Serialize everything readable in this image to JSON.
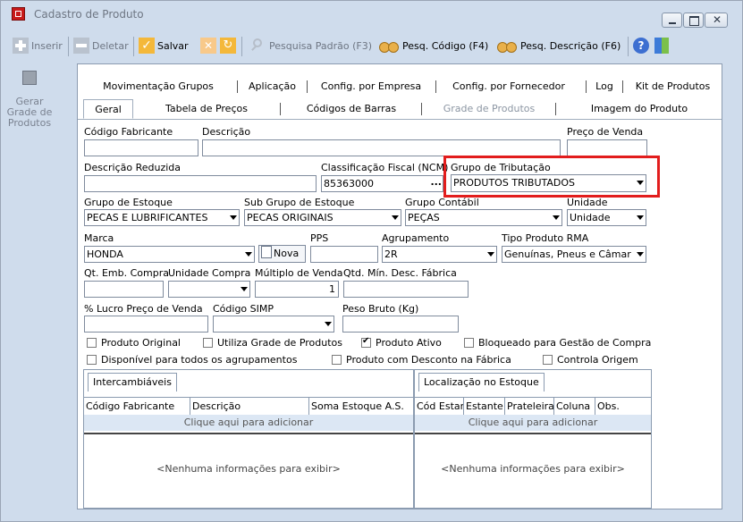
{
  "window": {
    "title": "Cadastro de Produto"
  },
  "toolbar": {
    "inserir": "Inserir",
    "deletar": "Deletar",
    "salvar": "Salvar",
    "pesquisa_padrao": "Pesquisa Padrão (F3)",
    "pesq_codigo": "Pesq. Código (F4)",
    "pesq_descricao": "Pesq. Descrição (F6)"
  },
  "side": {
    "gerar_grade": "Gerar Grade de Produtos"
  },
  "tabs_top": [
    "Movimentação Grupos",
    "Aplicação",
    "Config. por Empresa",
    "Config. por Fornecedor",
    "Log",
    "Kit de Produtos"
  ],
  "tabs_bottom": [
    "Geral",
    "Tabela de Preços",
    "Códigos de Barras",
    "Grade de Produtos",
    "Imagem do Produto"
  ],
  "form": {
    "codigo_fabricante": {
      "label": "Código Fabricante",
      "value": ""
    },
    "descricao": {
      "label": "Descrição",
      "value": ""
    },
    "preco_venda": {
      "label": "Preço de Venda",
      "value": ""
    },
    "descricao_reduzida": {
      "label": "Descrição Reduzida",
      "value": ""
    },
    "ncm": {
      "label": "Classificação Fiscal (NCM)",
      "value": "85363000",
      "button": "..."
    },
    "grupo_tributacao": {
      "label": "Grupo de Tributação",
      "value": "PRODUTOS TRIBUTADOS"
    },
    "grupo_estoque": {
      "label": "Grupo de Estoque",
      "value": "PECAS E LUBRIFICANTES"
    },
    "sub_grupo_estoque": {
      "label": "Sub Grupo de Estoque",
      "value": "PECAS ORIGINAIS"
    },
    "grupo_contabil": {
      "label": "Grupo Contábil",
      "value": "PEÇAS"
    },
    "unidade": {
      "label": "Unidade",
      "value": "Unidade"
    },
    "marca": {
      "label": "Marca",
      "value": "HONDA",
      "nova": "Nova"
    },
    "pps": {
      "label": "PPS",
      "value": ""
    },
    "agrupamento": {
      "label": "Agrupamento",
      "value": "2R"
    },
    "tipo_produto_rma": {
      "label": "Tipo Produto RMA",
      "value": "Genuínas, Pneus e Câmar"
    },
    "qt_emb_compra": {
      "label": "Qt. Emb. Compra",
      "value": ""
    },
    "unidade_compra": {
      "label": "Unidade Compra",
      "value": ""
    },
    "multiplo_venda": {
      "label": "Múltiplo de Venda",
      "value": "1"
    },
    "qtd_min_desc": {
      "label": "Qtd. Mín. Desc. Fábrica",
      "value": ""
    },
    "lucro_preco": {
      "label": "% Lucro Preço de Venda",
      "value": ""
    },
    "codigo_simp": {
      "label": "Código SIMP",
      "value": ""
    },
    "peso_bruto": {
      "label": "Peso Bruto (Kg)",
      "value": ""
    }
  },
  "checks": [
    {
      "label": "Produto Original",
      "checked": false
    },
    {
      "label": "Utiliza Grade de Produtos",
      "checked": false
    },
    {
      "label": "Produto Ativo",
      "checked": true
    },
    {
      "label": "Bloqueado para Gestão de Compra",
      "checked": false
    },
    {
      "label": "Disponível para todos os agrupamentos",
      "checked": false
    },
    {
      "label": "Produto com Desconto na Fábrica",
      "checked": false
    },
    {
      "label": "Controla Origem",
      "checked": false
    }
  ],
  "intercambiaveis": {
    "tab": "Intercambiáveis",
    "columns": [
      "Código Fabricante",
      "Descrição",
      "Soma Estoque A.S."
    ],
    "add": "Clique aqui para adicionar",
    "empty": "<Nenhuma informações para exibir>"
  },
  "localizacao": {
    "tab": "Localização no Estoque",
    "columns": [
      "Cód Estante",
      "Estante",
      "Prateleira",
      "Coluna",
      "Obs."
    ],
    "add": "Clique aqui para adicionar",
    "empty": "<Nenhuma informações para exibir>"
  }
}
